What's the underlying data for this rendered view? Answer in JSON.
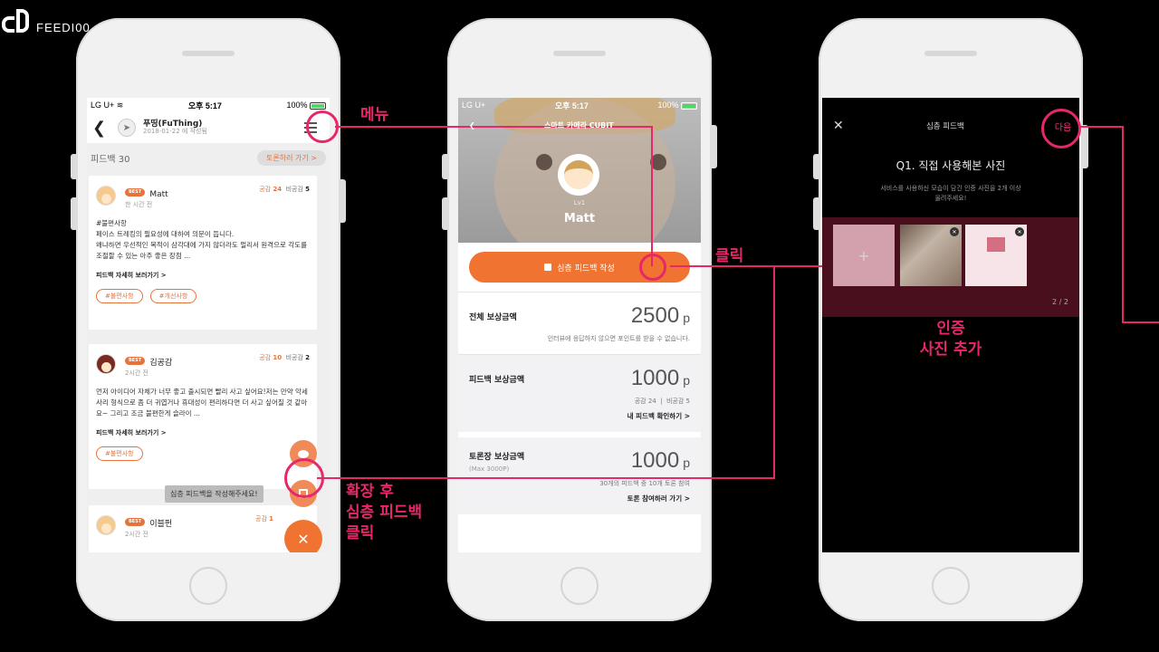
{
  "logo": {
    "text": "FEEDI00"
  },
  "phone1": {
    "status": {
      "carrier": "LG U+",
      "time": "오후 5:17",
      "battery": "100%"
    },
    "header": {
      "title": "푸띵(FuThing)",
      "date": "2018-01-22 에 작성됨"
    },
    "feedback_count": "피드백 30",
    "discuss_button": "토론하러 가기 >",
    "cards": [
      {
        "badge": "BEST",
        "name": "Matt",
        "time": "한 시간 전",
        "agree_label": "공감",
        "agree": "24",
        "disagree_label": "비공감",
        "disagree": "5",
        "body": "#불편사항\n페이스 트레킹의 필요성에 대하여 의문이 듭니다.\n왜냐하면 우선적인 목적이 삼각대에 가지 않더라도 멀리서 원격으로 각도를 조절할 수 있는 아주 좋은 장점 ...",
        "more": "피드백 자세히 보러가기 >",
        "tags": [
          "#불편사항",
          "#개선사항"
        ]
      },
      {
        "badge": "BEST",
        "name": "김공감",
        "time": "2시간 전",
        "agree_label": "공감",
        "agree": "10",
        "disagree_label": "비공감",
        "disagree": "2",
        "body": "먼저 아이디어 자체가 너무 좋고 출시되면 빨리 사고 싶어요!저는 만약 악세사리 형식으로 좀 더 귀엽거나 휴대성이 편리하다면 더 사고 싶어질 것 같아요~ 그리고 조금 불편한게 슬라이 ...",
        "more": "피드백 자세히 보러가기 >",
        "tags": [
          "#불편사항"
        ]
      },
      {
        "badge": "BEST",
        "name": "이블펀",
        "time": "2시간 전",
        "agree_label": "공감",
        "agree": "1"
      }
    ],
    "tooltip": "심층 피드백을 작성해주세요!"
  },
  "phone2": {
    "status": {
      "carrier": "LG U+",
      "time": "오후 5:17",
      "battery": "100%"
    },
    "nav_title": "스마트 카메라 CUBIT",
    "level": "Lv1",
    "user_name": "Matt",
    "write_button": "심층 피드백 작성",
    "rewards": [
      {
        "label": "전체 보상금액",
        "amount": "2500",
        "unit": "p",
        "note": "인터뷰에 응답하지 않으면 포인트를 받을 수 없습니다."
      },
      {
        "label": "피드백 보상금액",
        "amount": "1000",
        "unit": "p",
        "note": "공감 24  |  비공감 5",
        "link": "내 피드백 확인하기 >"
      },
      {
        "label": "토론장 보상금액",
        "sub": "(Max 3000P)",
        "amount": "1000",
        "unit": "p",
        "note": "30개의 피드백 중 10개 토론 참여",
        "link": "토론 참여하러 가기 >"
      }
    ]
  },
  "phone3": {
    "title": "심층 피드백",
    "next": "다음",
    "question": "Q1. 직접 사용해본 사진",
    "description": "서비스를 사용하신 모습이 담긴 인증 사진을 2개 이상\n올려주세요!",
    "pager": "2 / 2"
  },
  "annotations": {
    "menu": "메뉴",
    "click": "클릭",
    "expand": "확장 후\n심층 피드백\n클릭",
    "photo": "인증\n사진 추가"
  },
  "colors": {
    "accent": "#e6286b",
    "brand_orange": "#f07332"
  }
}
